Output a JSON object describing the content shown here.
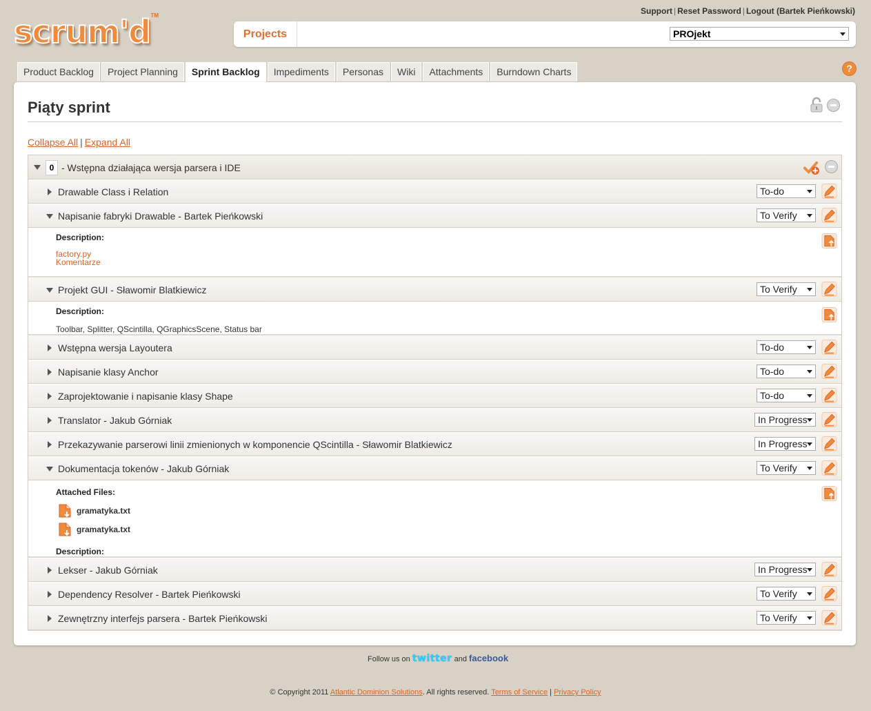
{
  "brand": {
    "logo_text": "scrum'd",
    "tm": "TM"
  },
  "top_links": {
    "support": "Support",
    "reset": "Reset Password",
    "logout": "Logout (Bartek Pieńkowski)",
    "sep": "|"
  },
  "project_bar": {
    "projects_label": "Projects",
    "selected_project": "PROjekt"
  },
  "tabs": [
    {
      "label": "Product Backlog"
    },
    {
      "label": "Project Planning"
    },
    {
      "label": "Sprint Backlog",
      "active": true
    },
    {
      "label": "Impediments"
    },
    {
      "label": "Personas"
    },
    {
      "label": "Wiki"
    },
    {
      "label": "Attachments"
    },
    {
      "label": "Burndown Charts"
    }
  ],
  "help_label": "?",
  "sprint": {
    "title": "Piąty sprint",
    "collapse_all": "Collapse All",
    "expand_all": "Expand All",
    "sep": "|"
  },
  "story": {
    "points": "0",
    "title": "- Wstępna działająca wersja parsera i IDE"
  },
  "tasks": [
    {
      "title": "Drawable Class i Relation",
      "owner": "",
      "status": "To-do"
    },
    {
      "title": "Napisanie fabryki Drawable",
      "owner": " - Bartek Pieńkowski",
      "status": "To Verify",
      "detail": {
        "description_label": "Description:",
        "links": [
          "factory.py",
          "Komentarze"
        ]
      }
    },
    {
      "title": "Projekt GUI",
      "owner": " - Sławomir Blatkiewicz",
      "status": "To Verify",
      "detail": {
        "description_label": "Description:",
        "text": "Toolbar, Splitter, QScintilla, QGraphicsScene, Status bar"
      }
    },
    {
      "title": "Wstępna wersja Layoutera",
      "owner": "",
      "status": "To-do"
    },
    {
      "title": "Napisanie klasy Anchor",
      "owner": "",
      "status": "To-do"
    },
    {
      "title": "Zaprojektowanie i napisanie klasy Shape",
      "owner": "",
      "status": "To-do"
    },
    {
      "title": "Translator",
      "owner": " - Jakub Górniak",
      "status": "In Progress"
    },
    {
      "title": "Przekazywanie parserowi linii zmienionych w komponencie QScintilla",
      "owner": " - Sławomir Blatkiewicz",
      "status": "In Progress"
    },
    {
      "title": "Dokumentacja tokenów",
      "owner": " - Jakub Górniak",
      "status": "To Verify",
      "detail": {
        "attached_label": "Attached Files:",
        "files": [
          "gramatyka.txt",
          "gramatyka.txt"
        ],
        "description_label": "Description:"
      }
    },
    {
      "title": "Lekser",
      "owner": " - Jakub Górniak",
      "status": "In Progress"
    },
    {
      "title": "Dependency Resolver",
      "owner": " - Bartek Pieńkowski",
      "status": "To Verify"
    },
    {
      "title": "Zewnętrzny interfejs parsera",
      "owner": " - Bartek Pieńkowski",
      "status": "To Verify"
    }
  ],
  "footer": {
    "follow_prefix": "Follow us on",
    "twitter": "twitter",
    "and": "and",
    "facebook": "facebook",
    "copyright": "© Copyright 2011",
    "company": "Atlantic Dominion Solutions",
    "rights": ". All rights reserved.",
    "terms": "Terms of Service",
    "sep": "|",
    "privacy": "Privacy Policy"
  },
  "colors": {
    "accent": "#f08a3c",
    "link": "#d5642b",
    "background": "#d8d2c6"
  }
}
